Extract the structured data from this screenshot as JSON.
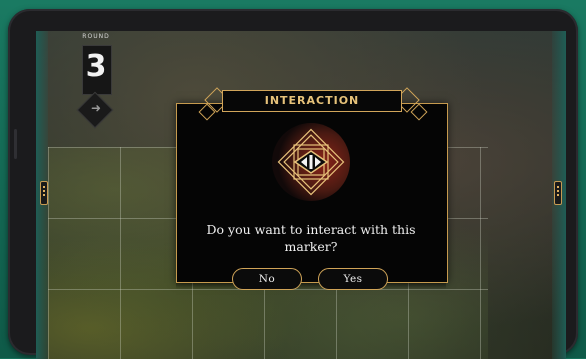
{
  "round": {
    "label": "ROUND",
    "number": "3",
    "end_icon": "next-arrow-icon"
  },
  "dialog": {
    "title": "INTERACTION",
    "question": "Do you want to interact with this marker?",
    "no_label": "No",
    "yes_label": "Yes",
    "emblem_icon": "art-deco-eye-marker-icon"
  },
  "colors": {
    "accent_gold": "#d0a458",
    "background_teal": "#16705a",
    "dialog_bg": "#050505",
    "emblem_red": "#8a2418"
  }
}
